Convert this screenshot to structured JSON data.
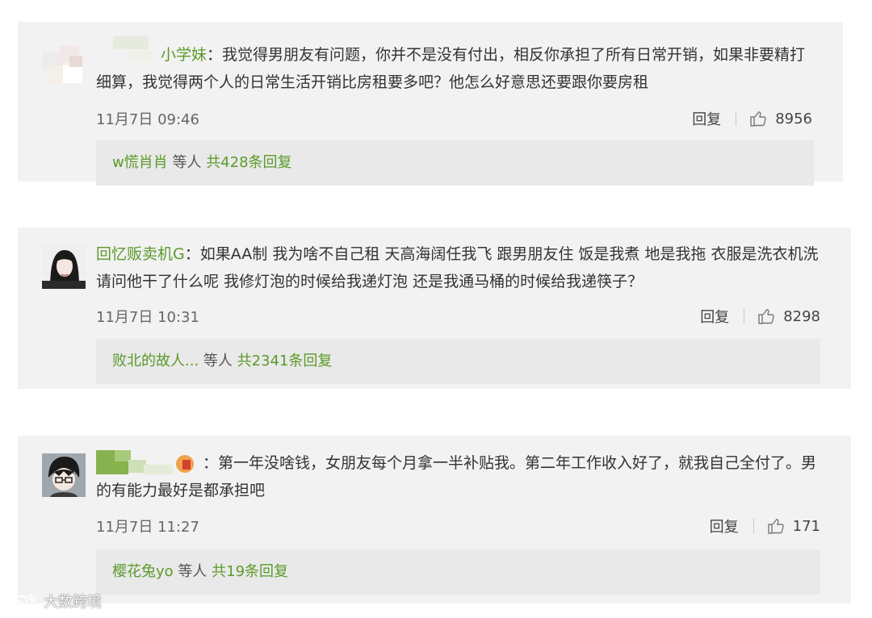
{
  "comments": [
    {
      "username": "小学妹",
      "text": "我觉得男朋友有问题，你并不是没有付出，相反你承担了所有日常开销，如果非要精打细算，我觉得两个人的日常生活开销比房租要多吧？他怎么好意思还要跟你要房租",
      "time": "11月7日 09:46",
      "reply_label": "回复",
      "likes": "8956",
      "reply_user": "w慌肖肖",
      "reply_mid": " 等人 ",
      "reply_count": "共428条回复"
    },
    {
      "username": "回忆贩卖机G",
      "text": "如果AA制 我为啥不自己租 天高海阔任我飞 跟男朋友住 饭是我煮 地是我拖 衣服是洗衣机洗 请问他干了什么呢 我修灯泡的时候给我递灯泡 还是我通马桶的时候给我递筷子？",
      "time": "11月7日 10:31",
      "reply_label": "回复",
      "likes": "8298",
      "reply_user": "败北的故人...",
      "reply_mid": " 等人 ",
      "reply_count": "共2341条回复"
    },
    {
      "username": "",
      "text": "第一年没啥钱，女朋友每个月拿一半补贴我。第二年工作收入好了，就我自己全付了。男的有能力最好是都承担吧",
      "time": "11月7日 11:27",
      "reply_label": "回复",
      "likes": "171",
      "reply_user": "樱花兔yo",
      "reply_mid": " 等人 ",
      "reply_count": "共19条回复"
    }
  ],
  "colon": "：",
  "watermark": "大数跨境",
  "colors": {
    "username": "#5b9a2a",
    "card_bg": "#f2f2f2",
    "reply_bg": "#e9e9e9"
  },
  "icons": [
    "thumbs-up-icon",
    "weibo-logo-icon"
  ]
}
